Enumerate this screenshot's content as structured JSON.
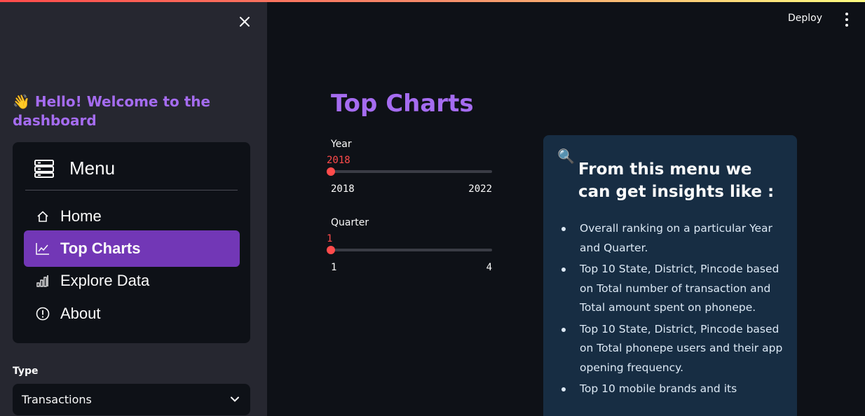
{
  "header": {
    "deploy_label": "Deploy",
    "accent_colors": [
      "#ff4b4b",
      "#fffd80"
    ]
  },
  "sidebar": {
    "welcome_emoji": "👋",
    "welcome_text": "Hello! Welcome to the dashboard",
    "menu_title": "Menu",
    "menu_icon": "menu-stack-icon",
    "items": [
      {
        "label": "Home",
        "icon": "home-icon",
        "active": false
      },
      {
        "label": "Top Charts",
        "icon": "line-chart-icon",
        "active": true
      },
      {
        "label": "Explore Data",
        "icon": "bar-chart-icon",
        "active": false
      },
      {
        "label": "About",
        "icon": "info-circle-icon",
        "active": false
      }
    ],
    "type_label": "Type",
    "type_value": "Transactions"
  },
  "main": {
    "title": "Top Charts",
    "year_slider": {
      "label": "Year",
      "value": "2018",
      "min": "2018",
      "max": "2022"
    },
    "quarter_slider": {
      "label": "Quarter",
      "value": "1",
      "min": "1",
      "max": "4"
    },
    "info": {
      "icon": "🔍",
      "heading": "From this menu we can get insights like :",
      "bullets": [
        "Overall ranking on a particular Year and Quarter.",
        "Top 10 State, District, Pincode based on Total number of transaction and Total amount spent on phonepe.",
        "Top 10 State, District, Pincode based on Total phonepe users and their app opening frequency.",
        "Top 10 mobile brands and its"
      ]
    }
  },
  "colors": {
    "accent_purple": "#a56cf0",
    "active_nav": "#7237b6",
    "slider_red": "#ff4b4b",
    "info_bg": "#172d43"
  }
}
